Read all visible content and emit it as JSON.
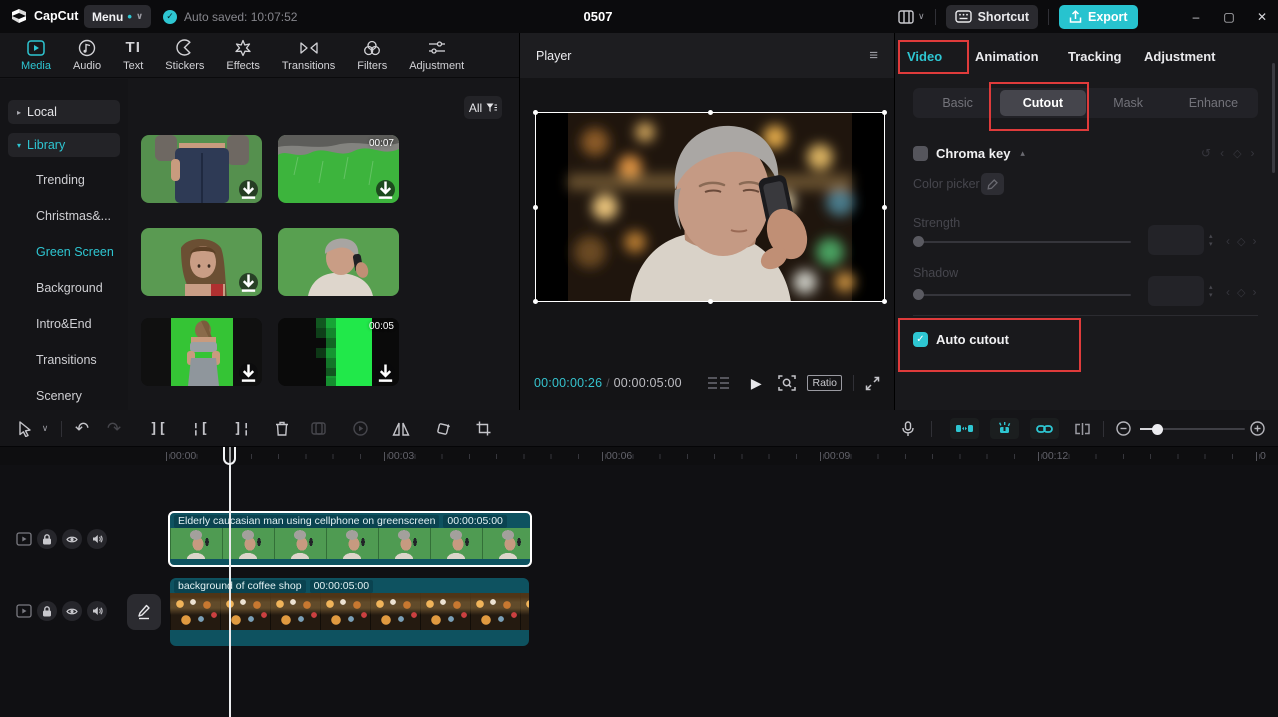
{
  "app": {
    "logo_text": "CapCut",
    "menu_label": "Menu",
    "autosave_text": "Auto saved: 10:07:52",
    "project_title": "0507",
    "shortcut_label": "Shortcut",
    "export_label": "Export"
  },
  "colors": {
    "accent": "#2ec6d2",
    "annotation": "#df3b3b",
    "clip": "#0e5260"
  },
  "icons": {
    "check": "✓",
    "chevron_down": "∨",
    "menu_dot": "•",
    "caret_right": "▸",
    "caret_down": "▾",
    "collapse_up": "▴",
    "hamburger": "≡",
    "play": "▶",
    "undo": "↶",
    "redo": "↷",
    "split": "][",
    "delete_left": "¦[",
    "delete_right": "]¦",
    "reset": "↺",
    "keyframe_prev": "‹",
    "keyframe_next": "›",
    "keyframe_diamond": "◇",
    "stepper_up": "▴",
    "stepper_down": "▾",
    "minimize": "–",
    "maximize": "▢",
    "close": "✕",
    "audio_note": "♪",
    "text_tab_glyph": "TI"
  },
  "media_panel": {
    "tabs": [
      {
        "label": "Media",
        "active": true
      },
      {
        "label": "Audio"
      },
      {
        "label": "Text"
      },
      {
        "label": "Stickers"
      },
      {
        "label": "Effects"
      },
      {
        "label": "Transitions"
      },
      {
        "label": "Filters"
      },
      {
        "label": "Adjustment"
      }
    ],
    "sidebar": {
      "local_label": "Local",
      "library_label": "Library",
      "items": [
        {
          "label": "Trending"
        },
        {
          "label": "Christmas&..."
        },
        {
          "label": "Green Screen",
          "active": true
        },
        {
          "label": "Background"
        },
        {
          "label": "Intro&End"
        },
        {
          "label": "Transitions"
        },
        {
          "label": "Scenery"
        }
      ]
    },
    "filter_label": "All",
    "thumbnails": [
      {
        "desc": "woman in jeans on green screen",
        "duration": ""
      },
      {
        "desc": "storm clouds over green screen",
        "duration": "00:07"
      },
      {
        "desc": "woman portrait on green screen",
        "duration": ""
      },
      {
        "desc": "elderly man on phone green screen",
        "duration": ""
      },
      {
        "desc": "sporty woman on green screen",
        "duration": ""
      },
      {
        "desc": "pixel green transition",
        "duration": "00:05"
      }
    ]
  },
  "player": {
    "title": "Player",
    "current_time": "00:00:00:26",
    "separator": "/",
    "total_time": "00:00:05:00",
    "ratio_label": "Ratio"
  },
  "inspector": {
    "tabs": [
      {
        "label": "Video",
        "active": true
      },
      {
        "label": "Animation"
      },
      {
        "label": "Tracking"
      },
      {
        "label": "Adjustment"
      }
    ],
    "segments": [
      {
        "label": "Basic"
      },
      {
        "label": "Cutout",
        "selected": true
      },
      {
        "label": "Mask"
      },
      {
        "label": "Enhance"
      }
    ],
    "chroma_key_label": "Chroma key",
    "color_picker_label": "Color picker",
    "strength_label": "Strength",
    "shadow_label": "Shadow",
    "auto_cutout_label": "Auto cutout",
    "auto_cutout_checked": true
  },
  "timeline": {
    "ruler_labels": [
      "00:00",
      "00:03",
      "00:06",
      "00:09",
      "00:12",
      "0"
    ],
    "clips": [
      {
        "name": "Elderly caucasian man using cellphone on greenscreen",
        "duration": "00:00:05:00"
      },
      {
        "name": "background of coffee shop",
        "duration": "00:00:05:00"
      }
    ]
  }
}
